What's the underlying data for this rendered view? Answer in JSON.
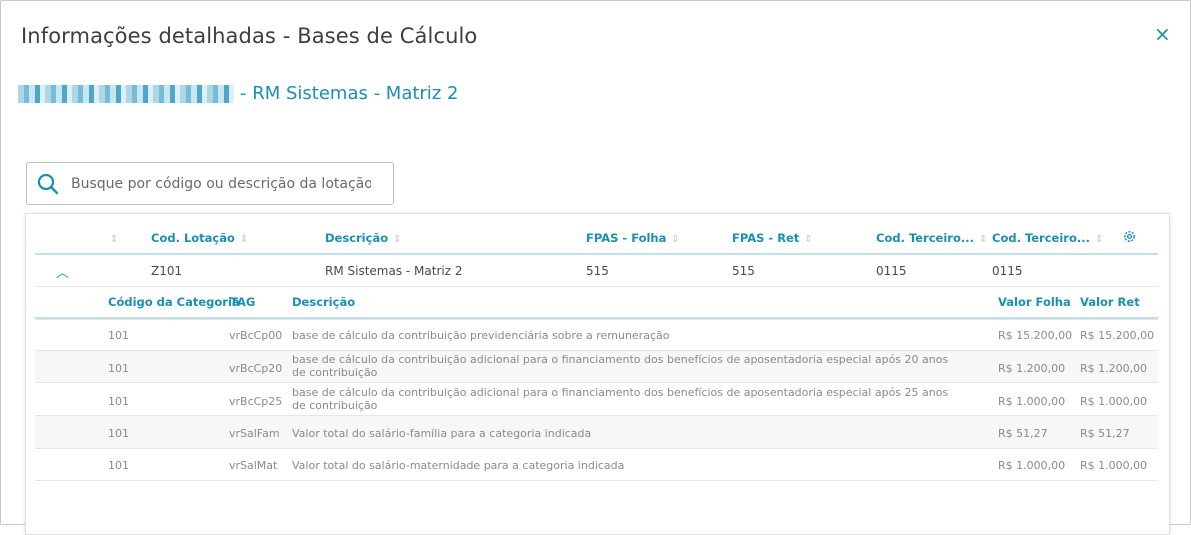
{
  "dialog": {
    "title": "Informações detalhadas - Bases de Cálculo",
    "close_label": "×",
    "subtitle": "- RM Sistemas - Matriz 2"
  },
  "search": {
    "placeholder": "Busque por código ou descrição da lotação"
  },
  "table": {
    "columns": [
      "Cod. Lotação",
      "Descrição",
      "FPAS - Folha",
      "FPAS - Ret",
      "Cod. Terceiro...",
      "Cod. Terceiro..."
    ],
    "row": {
      "cod_lotacao": "Z101",
      "descricao": "RM Sistemas - Matriz 2",
      "fpas_folha": "515",
      "fpas_ret": "515",
      "cod_terceiro_1": "0115",
      "cod_terceiro_2": "0115"
    }
  },
  "detail": {
    "columns": [
      "Código da Categoria",
      "TAG",
      "Descrição",
      "Valor Folha",
      "Valor Ret"
    ],
    "rows": [
      {
        "codigo": "101",
        "tag": "vrBcCp00",
        "descricao": "base de cálculo da contribuição previdenciária sobre a remuneração",
        "valor_folha": "R$ 15.200,00",
        "valor_ret": "R$ 15.200,00"
      },
      {
        "codigo": "101",
        "tag": "vrBcCp20",
        "descricao": "base de cálculo da contribuição adicional para o financiamento dos benefícios de aposentadoria especial após 20 anos de contribuição",
        "valor_folha": "R$ 1.200,00",
        "valor_ret": "R$ 1.200,00"
      },
      {
        "codigo": "101",
        "tag": "vrBcCp25",
        "descricao": "base de cálculo da contribuição adicional para o financiamento dos benefícios de aposentadoria especial após 25 anos de contribuição",
        "valor_folha": "R$ 1.000,00",
        "valor_ret": "R$ 1.000,00"
      },
      {
        "codigo": "101",
        "tag": "vrSalFam",
        "descricao": "Valor total do salário-família para a categoria indicada",
        "valor_folha": "R$ 51,27",
        "valor_ret": "R$ 51,27"
      },
      {
        "codigo": "101",
        "tag": "vrSalMat",
        "descricao": "Valor total do salário-maternidade para a categoria indicada",
        "valor_folha": "R$ 1.000,00",
        "valor_ret": "R$ 1.000,00"
      }
    ]
  },
  "icons": {
    "search": "search-icon",
    "close": "close-icon",
    "settings": "gear-icon",
    "collapse": "chevron-up-icon",
    "sort": "sort-icon"
  },
  "colors": {
    "accent": "#1a8fb4",
    "text": "#4a4a4a",
    "muted": "#8a8a8a"
  }
}
